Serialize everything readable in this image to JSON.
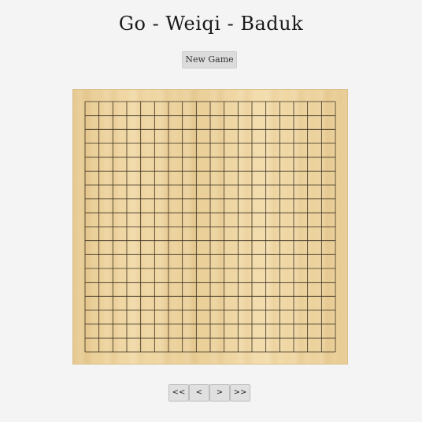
{
  "title": "Go - Weiqi - Baduk",
  "controls": {
    "new_game_label": "New Game"
  },
  "board": {
    "size": 19,
    "line_color": "#3a3020",
    "wood_color": "#eed4a0"
  },
  "navigation": {
    "first_label": "<<",
    "prev_label": "<",
    "next_label": ">",
    "last_label": ">>"
  }
}
